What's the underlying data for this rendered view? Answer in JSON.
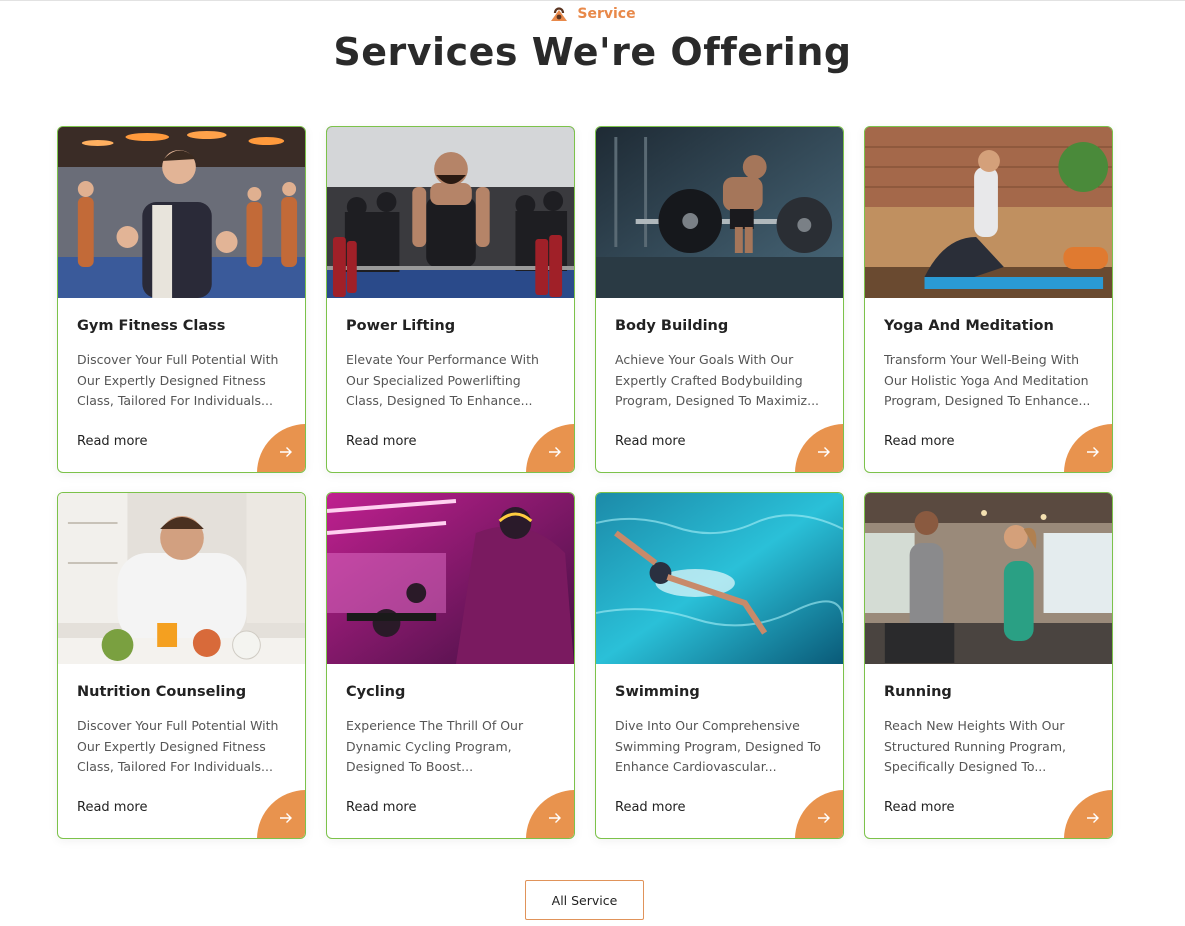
{
  "header": {
    "eyebrow": "Service",
    "eyebrow_icon": "kettlebell-icon",
    "title": "Services We're Offering"
  },
  "accent_color": "#e8934e",
  "card_border_color": "#7cc24a",
  "cards": [
    {
      "title": "Gym Fitness Class",
      "description": "Discover Your Full Potential With Our Expertly Designed Fitness Class, Tailored For Individuals...",
      "link": "Read more",
      "image": "gym-class-photo"
    },
    {
      "title": "Power Lifting",
      "description": "Elevate Your Performance With Our Specialized Powerlifting Class, Designed To Enhance...",
      "link": "Read more",
      "image": "powerlifting-photo"
    },
    {
      "title": "Body Building",
      "description": "Achieve Your Goals With Our Expertly Crafted Bodybuilding Program, Designed To Maximiz...",
      "link": "Read more",
      "image": "bodybuilding-photo"
    },
    {
      "title": "Yoga And Meditation",
      "description": "Transform Your Well-Being With Our Holistic Yoga And Meditation Program, Designed To Enhance...",
      "link": "Read more",
      "image": "yoga-photo"
    },
    {
      "title": "Nutrition Counseling",
      "description": "Discover Your Full Potential With Our Expertly Designed Fitness Class, Tailored For Individuals...",
      "link": "Read more",
      "image": "nutrition-photo"
    },
    {
      "title": "Cycling",
      "description": "Experience The Thrill Of Our Dynamic Cycling Program, Designed To Boost...",
      "link": "Read more",
      "image": "cycling-photo"
    },
    {
      "title": "Swimming",
      "description": "Dive Into Our Comprehensive Swimming Program, Designed To Enhance Cardiovascular...",
      "link": "Read more",
      "image": "swimming-photo"
    },
    {
      "title": "Running",
      "description": "Reach New Heights With Our Structured Running Program, Specifically Designed To...",
      "link": "Read more",
      "image": "running-photo"
    }
  ],
  "all_service_label": "All Service"
}
